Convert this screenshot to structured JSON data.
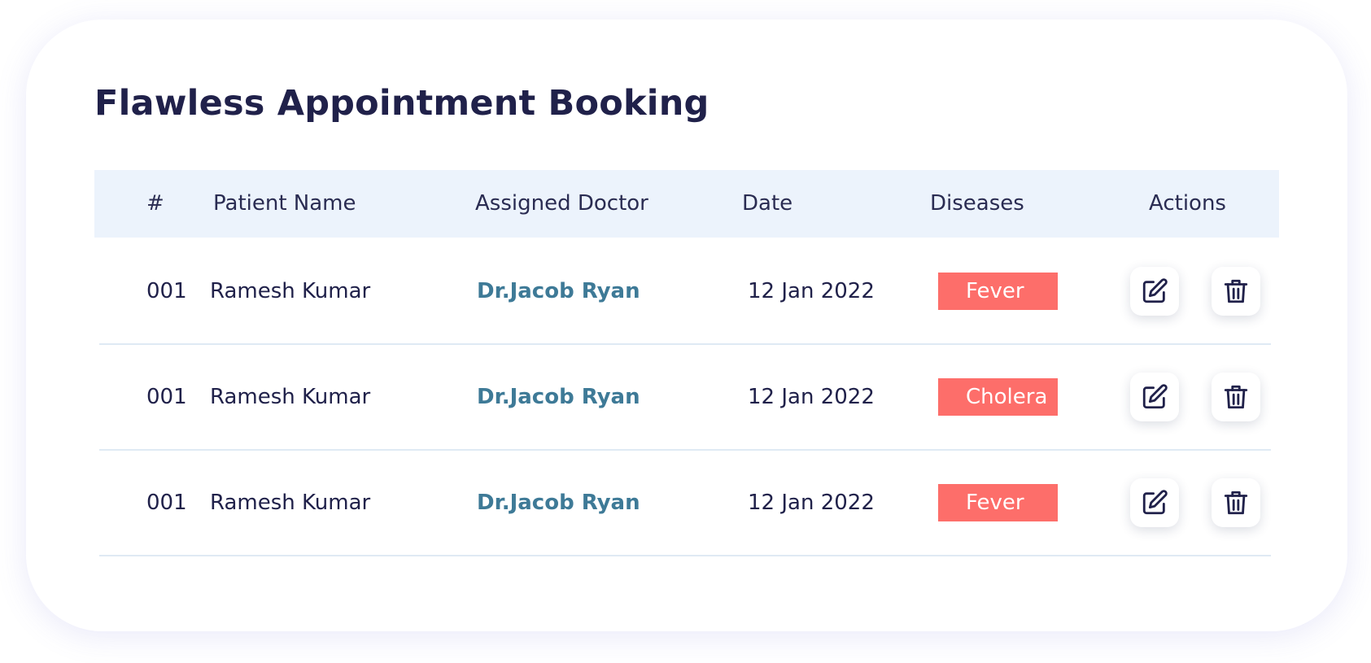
{
  "title": "Flawless Appointment Booking",
  "table": {
    "columns": [
      "#",
      "Patient Name",
      "Assigned Doctor",
      "Date",
      "Diseases",
      "Actions"
    ],
    "rows": [
      {
        "id": "001",
        "patient": "Ramesh Kumar",
        "doctor": "Dr.Jacob Ryan",
        "date": "12 Jan 2022",
        "disease": "Fever"
      },
      {
        "id": "001",
        "patient": "Ramesh Kumar",
        "doctor": "Dr.Jacob Ryan",
        "date": "12 Jan 2022",
        "disease": "Cholera"
      },
      {
        "id": "001",
        "patient": "Ramesh Kumar",
        "doctor": "Dr.Jacob Ryan",
        "date": "12 Jan 2022",
        "disease": "Fever"
      }
    ],
    "actions": {
      "edit_icon": "edit-icon",
      "delete_icon": "trash-icon"
    }
  },
  "colors": {
    "title": "#20214a",
    "header_bg": "#ecf3fc",
    "doctor_link": "#3e7a97",
    "badge": "#fd6e6a",
    "divider": "#dfeaf4"
  }
}
